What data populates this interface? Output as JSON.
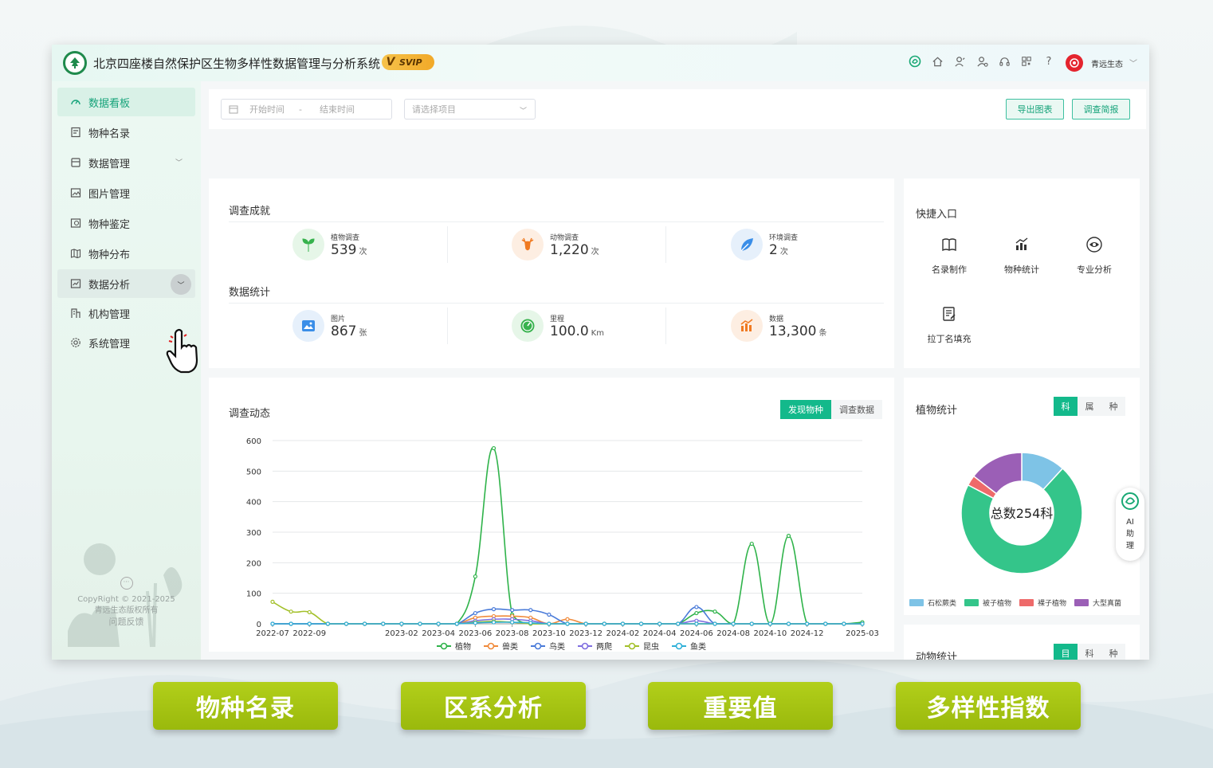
{
  "app": {
    "title": "北京四座楼自然保护区生物多样性数据管理与分析系统",
    "badge": "SVIP",
    "badge_prefix": "V"
  },
  "header": {
    "icons": [
      "ai-logo-icon",
      "home-icon",
      "plant-user-icon",
      "user-settings-icon",
      "headset-icon",
      "qrcode-icon",
      "help-icon"
    ],
    "help_label": "?",
    "user_name": "青远生态",
    "user_chevron": "﹀"
  },
  "sidebar": {
    "items": [
      {
        "label": "数据看板",
        "icon": "dashboard-icon",
        "active": true
      },
      {
        "label": "物种名录",
        "icon": "list-icon"
      },
      {
        "label": "数据管理",
        "icon": "database-icon",
        "chevron": "﹀"
      },
      {
        "label": "图片管理",
        "icon": "image-icon"
      },
      {
        "label": "物种鉴定",
        "icon": "identify-icon"
      },
      {
        "label": "物种分布",
        "icon": "map-icon"
      },
      {
        "label": "数据分析",
        "icon": "analysis-icon",
        "chevron": "﹀"
      },
      {
        "label": "机构管理",
        "icon": "org-icon"
      },
      {
        "label": "系统管理",
        "icon": "settings-icon",
        "chevron": "﹀"
      }
    ],
    "footer": {
      "copyright": "CopyRight © 2021-2025",
      "owner": "青远生态版权所有",
      "feedback": "问题反馈",
      "dots": "···"
    }
  },
  "filters": {
    "start_placeholder": "开始时间",
    "separator": "-",
    "end_placeholder": "结束时间",
    "project_placeholder": "请选择项目",
    "export_label": "导出图表",
    "report_label": "调查简报"
  },
  "achievements": {
    "title": "调查成就",
    "items": [
      {
        "label": "植物调查",
        "value": "539",
        "unit": "次"
      },
      {
        "label": "动物调查",
        "value": "1,220",
        "unit": "次"
      },
      {
        "label": "环境调查",
        "value": "2",
        "unit": "次"
      }
    ]
  },
  "statistics": {
    "title": "数据统计",
    "items": [
      {
        "label": "图片",
        "value": "867",
        "unit": "张"
      },
      {
        "label": "里程",
        "value": "100.0",
        "unit": "Km"
      },
      {
        "label": "数据",
        "value": "13,300",
        "unit": "条"
      }
    ]
  },
  "quick_entry": {
    "title": "快捷入口",
    "items": [
      {
        "label": "名录制作",
        "icon": "book-icon"
      },
      {
        "label": "物种统计",
        "icon": "bar-stat-icon"
      },
      {
        "label": "专业分析",
        "icon": "analysis-eye-icon"
      },
      {
        "label": "拉丁名填充",
        "icon": "edit-doc-icon"
      }
    ]
  },
  "trend": {
    "title": "调查动态",
    "tabs": [
      {
        "label": "发现物种",
        "active": true
      },
      {
        "label": "调查数据"
      }
    ]
  },
  "plant_stats": {
    "title": "植物统计",
    "tabs": [
      {
        "label": "科",
        "active": true
      },
      {
        "label": "属"
      },
      {
        "label": "种"
      }
    ],
    "center_label": "总数254科",
    "legend": [
      "石松蕨类",
      "被子植物",
      "裸子植物",
      "大型真菌"
    ]
  },
  "animal_stats": {
    "title": "动物统计",
    "tabs": [
      {
        "label": "目",
        "active": true
      },
      {
        "label": "科"
      },
      {
        "label": "种"
      }
    ]
  },
  "ai_helper": {
    "line1": "AI",
    "line2": "助",
    "line3": "理"
  },
  "features": [
    "物种名录",
    "区系分析",
    "重要值",
    "多样性指数"
  ],
  "colors": {
    "accent": "#13b98b",
    "plant": "#2fb34a",
    "beast": "#f08a3a",
    "bird": "#4a7bd9",
    "amphibian": "#7f6ee0",
    "insect": "#a3c02a",
    "fish": "#2fb0d8",
    "donut_fern": "#7ec3e6",
    "donut_angio": "#34c58a",
    "donut_gymno": "#ee6a6a",
    "donut_fungi": "#9b5fb6",
    "feature_green": "#a6c414"
  },
  "chart_data": [
    {
      "type": "line",
      "title": "",
      "x": [
        "2022-07",
        "2022-08",
        "2022-09",
        "2022-10",
        "2022-11",
        "2022-12",
        "2023-01",
        "2023-02",
        "2023-03",
        "2023-04",
        "2023-05",
        "2023-06",
        "2023-07",
        "2023-08",
        "2023-09",
        "2023-10",
        "2023-11",
        "2023-12",
        "2024-01",
        "2024-02",
        "2024-03",
        "2024-04",
        "2024-05",
        "2024-06",
        "2024-07",
        "2024-08",
        "2024-09",
        "2024-10",
        "2024-11",
        "2024-12",
        "2025-01",
        "2025-02",
        "2025-03"
      ],
      "x_tick_labels": [
        "2022-07",
        "2022-09",
        "2023-02",
        "2023-04",
        "2023-06",
        "2023-08",
        "2023-10",
        "2023-12",
        "2024-02",
        "2024-04",
        "2024-06",
        "2024-08",
        "2024-10",
        "2024-12",
        "2025-03"
      ],
      "ylim": [
        0,
        600
      ],
      "yticks": [
        0,
        100,
        200,
        300,
        400,
        500,
        600
      ],
      "grid": true,
      "legend_position": "bottom",
      "series": [
        {
          "name": "植物",
          "color": "#2fb34a",
          "values": [
            0,
            0,
            0,
            0,
            0,
            0,
            0,
            0,
            0,
            0,
            0,
            155,
            575,
            30,
            0,
            0,
            0,
            0,
            0,
            0,
            0,
            0,
            0,
            35,
            40,
            0,
            262,
            0,
            288,
            0,
            0,
            0,
            5
          ]
        },
        {
          "name": "兽类",
          "color": "#f08a3a",
          "values": [
            0,
            0,
            0,
            0,
            0,
            0,
            0,
            0,
            0,
            0,
            0,
            20,
            25,
            25,
            20,
            0,
            15,
            0,
            0,
            0,
            0,
            0,
            0,
            0,
            0,
            0,
            0,
            0,
            0,
            0,
            0,
            0,
            0
          ]
        },
        {
          "name": "鸟类",
          "color": "#4a7bd9",
          "values": [
            0,
            0,
            0,
            0,
            0,
            0,
            0,
            0,
            0,
            0,
            0,
            35,
            48,
            45,
            45,
            30,
            0,
            0,
            0,
            0,
            0,
            0,
            0,
            55,
            0,
            0,
            0,
            0,
            0,
            0,
            0,
            0,
            0
          ]
        },
        {
          "name": "两爬",
          "color": "#7f6ee0",
          "values": [
            0,
            0,
            0,
            0,
            0,
            0,
            0,
            0,
            0,
            0,
            0,
            10,
            15,
            15,
            10,
            0,
            0,
            0,
            0,
            0,
            0,
            0,
            0,
            10,
            0,
            0,
            0,
            0,
            0,
            0,
            0,
            0,
            0
          ]
        },
        {
          "name": "昆虫",
          "color": "#a3c02a",
          "values": [
            72,
            40,
            38,
            0,
            0,
            0,
            0,
            0,
            0,
            0,
            0,
            5,
            8,
            5,
            0,
            0,
            0,
            0,
            0,
            0,
            0,
            0,
            0,
            0,
            0,
            0,
            0,
            0,
            0,
            0,
            0,
            0,
            0
          ]
        },
        {
          "name": "鱼类",
          "color": "#2fb0d8",
          "values": [
            0,
            0,
            0,
            0,
            0,
            0,
            0,
            0,
            0,
            0,
            0,
            3,
            5,
            5,
            3,
            0,
            0,
            0,
            0,
            0,
            0,
            0,
            0,
            0,
            0,
            0,
            0,
            0,
            0,
            0,
            0,
            0,
            0
          ]
        }
      ]
    },
    {
      "type": "pie",
      "title": "",
      "center_label": "总数254科",
      "categories": [
        "石松蕨类",
        "被子植物",
        "裸子植物",
        "大型真菌"
      ],
      "values": [
        30,
        180,
        7,
        37
      ],
      "legend_position": "bottom"
    }
  ]
}
